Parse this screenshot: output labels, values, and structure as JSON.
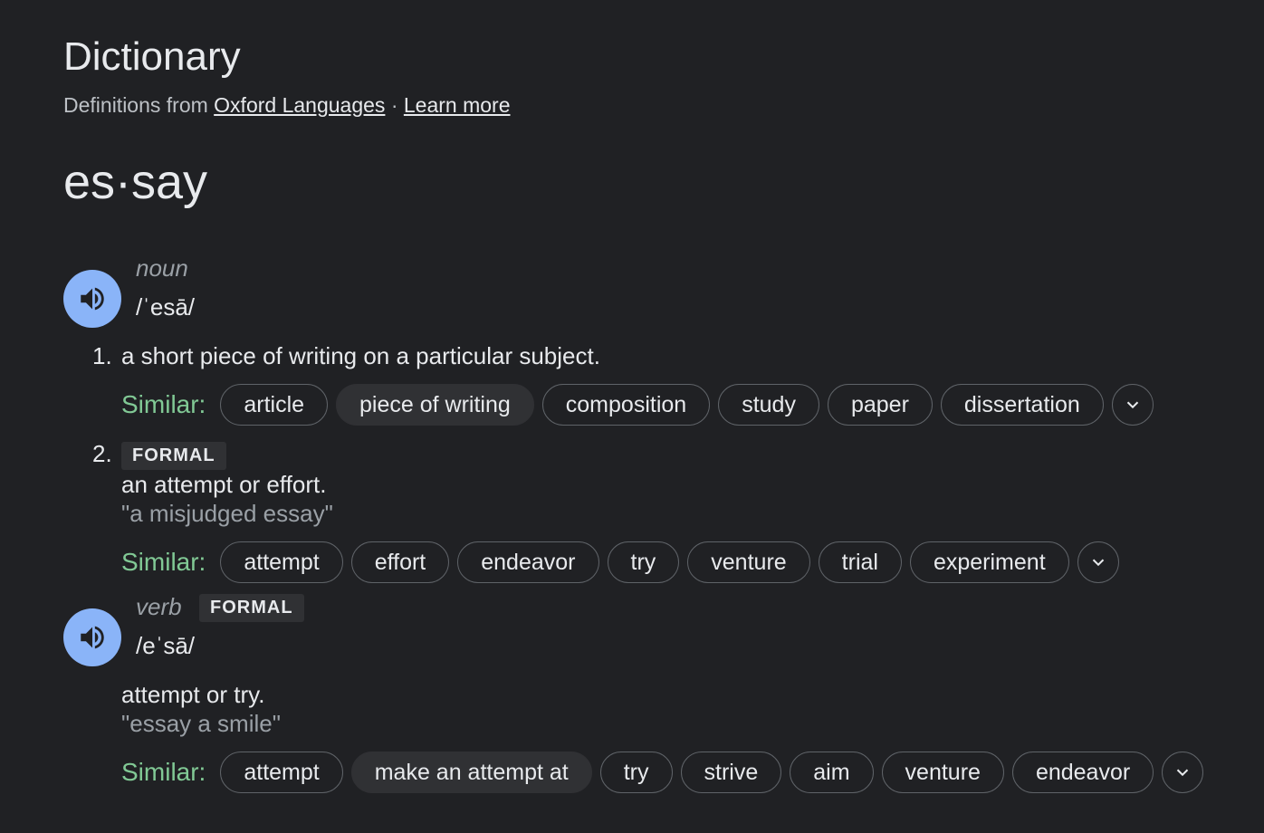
{
  "header": {
    "title": "Dictionary",
    "source_prefix": "Definitions from",
    "source_link": "Oxford Languages",
    "separator": "·",
    "learn_more": "Learn more"
  },
  "headword": "es·say",
  "noun": {
    "pos": "noun",
    "phonetic": "/ˈesā/",
    "definitions": [
      {
        "number": "1.",
        "text": "a short piece of writing on a particular subject.",
        "similar_label": "Similar:",
        "similar": [
          "article",
          "piece of writing",
          "composition",
          "study",
          "paper",
          "dissertation"
        ]
      },
      {
        "number": "2.",
        "label": "FORMAL",
        "text": "an attempt or effort.",
        "example": "\"a misjudged essay\"",
        "similar_label": "Similar:",
        "similar": [
          "attempt",
          "effort",
          "endeavor",
          "try",
          "venture",
          "trial",
          "experiment"
        ]
      }
    ]
  },
  "verb": {
    "pos": "verb",
    "label": "FORMAL",
    "phonetic": "/eˈsā/",
    "text": "attempt or try.",
    "example": "\"essay a smile\"",
    "similar_label": "Similar:",
    "similar": [
      "attempt",
      "make an attempt at",
      "try",
      "strive",
      "aim",
      "venture",
      "endeavor"
    ]
  },
  "icons": {
    "speaker": "speaker-icon",
    "expand": "chevron-down-icon"
  },
  "colors": {
    "background": "#202124",
    "speaker_bg": "#8ab4f8",
    "similar_label": "#81c995",
    "chip_border": "#5f6368",
    "chip_highlight": "#303134"
  }
}
